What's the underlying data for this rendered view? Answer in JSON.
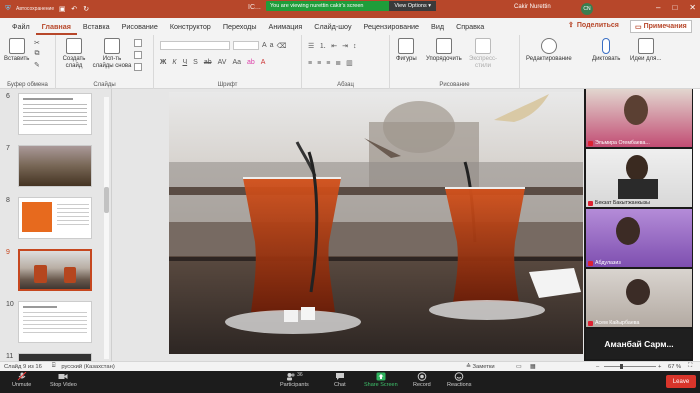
{
  "titlebar": {
    "autosave_label": "Автосохранение",
    "doc_title": "IC...",
    "share_banner_text": "You are viewing nurettin cakir's screen",
    "view_options": "View Options",
    "user_name": "Cakir Nurettin",
    "user_initials": "CN"
  },
  "ribbon_tabs": [
    "Файл",
    "Главная",
    "Вставка",
    "Рисование",
    "Конструктор",
    "Переходы",
    "Анимация",
    "Слайд-шоу",
    "Рецензирование",
    "Вид",
    "Справка"
  ],
  "active_tab": "Главная",
  "share_label": "Поделиться",
  "notes_label": "Примечания",
  "ribbon": {
    "paste_label": "Вставить",
    "new_slide_label": "Создать слайд",
    "reuse_label": "Исп-ть слайды снова",
    "clipboard_group": "Буфер обмена",
    "slides_group": "Слайды",
    "font_group": "Шрифт",
    "paragraph_group": "Абзац",
    "shapes_label": "Фигуры",
    "arrange_label": "Упорядочить",
    "quick_styles_label": "Экспресс-стили",
    "drawing_group": "Рисование",
    "editing_label": "Редактирование",
    "dictate_label": "Диктовать",
    "design_ideas_label": "Идеи для..."
  },
  "thumbnails": [
    {
      "num": "6"
    },
    {
      "num": "7"
    },
    {
      "num": "8"
    },
    {
      "num": "9"
    },
    {
      "num": "10"
    },
    {
      "num": "11"
    }
  ],
  "selected_slide": "9",
  "participants": [
    {
      "name": "Эльмира Огембаева..."
    },
    {
      "name": "Бекзат Бакытжанкызы"
    },
    {
      "name": "Абдулазиз"
    },
    {
      "name": "Асем Кайырбаева"
    },
    {
      "name": "Аманбай Сарм..."
    }
  ],
  "statusbar": {
    "slide_info": "Слайд 9 из 16",
    "language": "русский (Казахстан)",
    "notes": "Заметки",
    "zoom": "67 %"
  },
  "zoom_toolbar": {
    "unmute": "Unmute",
    "stop_video": "Stop Video",
    "participants": "Participants",
    "participants_count": "36",
    "chat": "Chat",
    "share_screen": "Share Screen",
    "record": "Record",
    "reactions": "Reactions",
    "leave": "Leave"
  },
  "colors": {
    "accent": "#b7472a",
    "share_green": "#1f9d3a",
    "leave_red": "#d9352b"
  }
}
